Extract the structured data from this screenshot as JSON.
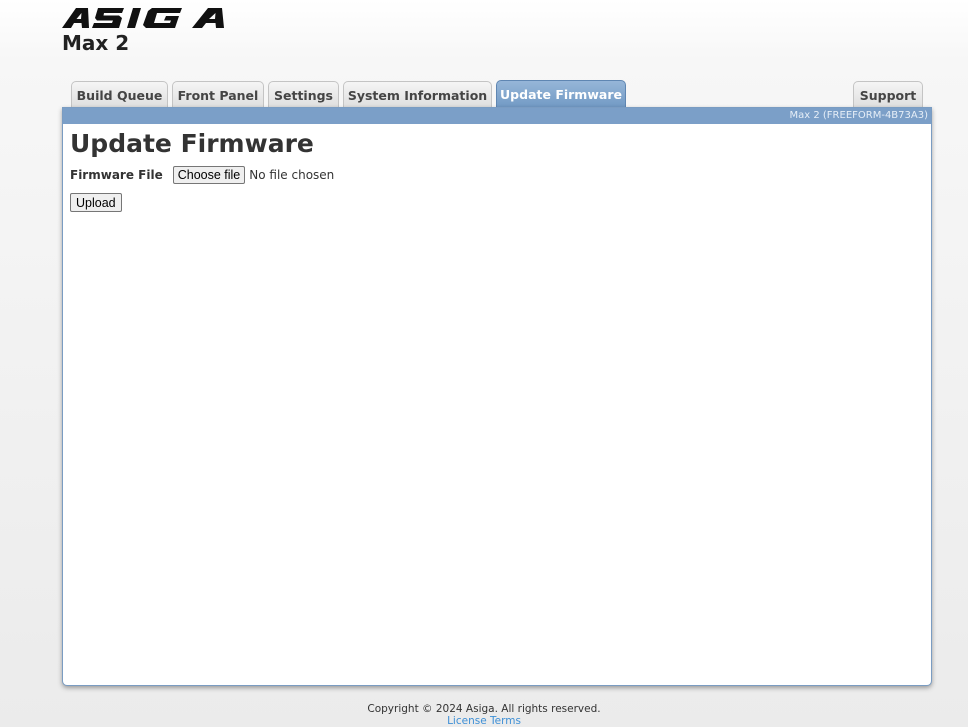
{
  "brand": {
    "logo_text": "ASIGA",
    "model": "Max 2"
  },
  "tabs": [
    {
      "label": "Build Queue",
      "active": false
    },
    {
      "label": "Front Panel",
      "active": false
    },
    {
      "label": "Settings",
      "active": false
    },
    {
      "label": "System Information",
      "active": false
    },
    {
      "label": "Update Firmware",
      "active": true
    },
    {
      "label": "Support",
      "active": false
    }
  ],
  "panel": {
    "device_id": "Max 2 (FREEFORM-4B73A3)",
    "heading": "Update Firmware",
    "firmware_label": "Firmware File",
    "choose_file_label": "Choose file",
    "file_status": "No file chosen",
    "upload_label": "Upload"
  },
  "footer": {
    "copyright": "Copyright © 2024 Asiga. All rights reserved.",
    "license_link": "License Terms"
  },
  "colors": {
    "accent": "#7b9fc8",
    "active_tab": "#7199c4",
    "link": "#3d8fd6"
  }
}
